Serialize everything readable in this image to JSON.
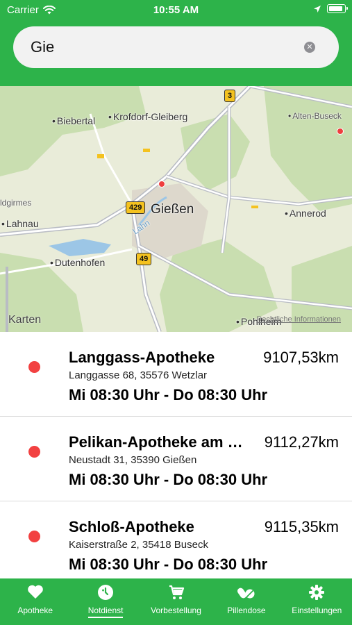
{
  "status_bar": {
    "carrier": "Carrier",
    "time": "10:55 AM"
  },
  "search": {
    "value": "Gie"
  },
  "map": {
    "labels": {
      "biebertal": "Biebertal",
      "krofdorf": "Krofdorf-Gleiberg",
      "alten_buseck": "Alten-Buseck",
      "dgirmes": "ldgirmes",
      "lahnau": "Lahnau",
      "giessen": "Gießen",
      "annerod": "Annerod",
      "dutenhofen": "Dutenhofen",
      "pohlheim": "Pohlheim",
      "lahn": "Lahn"
    },
    "shields": {
      "a": "3",
      "b": "429",
      "c": "49"
    },
    "credit": "Karten",
    "legal": "Rechtliche Informationen"
  },
  "pharmacies": [
    {
      "name": "Langgass-Apotheke",
      "distance": "9107,53km",
      "address": "Langgasse 68, 35576 Wetzlar",
      "hours": "Mi 08:30 Uhr - Do 08:30 Uhr"
    },
    {
      "name": "Pelikan-Apotheke am Markt",
      "distance": "9112,27km",
      "address": "Neustadt 31, 35390 Gießen",
      "hours": "Mi 08:30 Uhr - Do 08:30 Uhr"
    },
    {
      "name": "Schloß-Apotheke",
      "distance": "9115,35km",
      "address": "Kaiserstraße 2, 35418 Buseck",
      "hours": "Mi 08:30 Uhr - Do 08:30 Uhr"
    }
  ],
  "tabs": [
    {
      "label": "Apotheke",
      "icon": "heart-icon"
    },
    {
      "label": "Notdienst",
      "icon": "medical-clock-icon"
    },
    {
      "label": "Vorbestellung",
      "icon": "cart-icon"
    },
    {
      "label": "Pillendose",
      "icon": "pills-icon"
    },
    {
      "label": "Einstellungen",
      "icon": "gear-icon"
    }
  ],
  "colors": {
    "brand": "#2db34a",
    "pin": "#f24141"
  }
}
